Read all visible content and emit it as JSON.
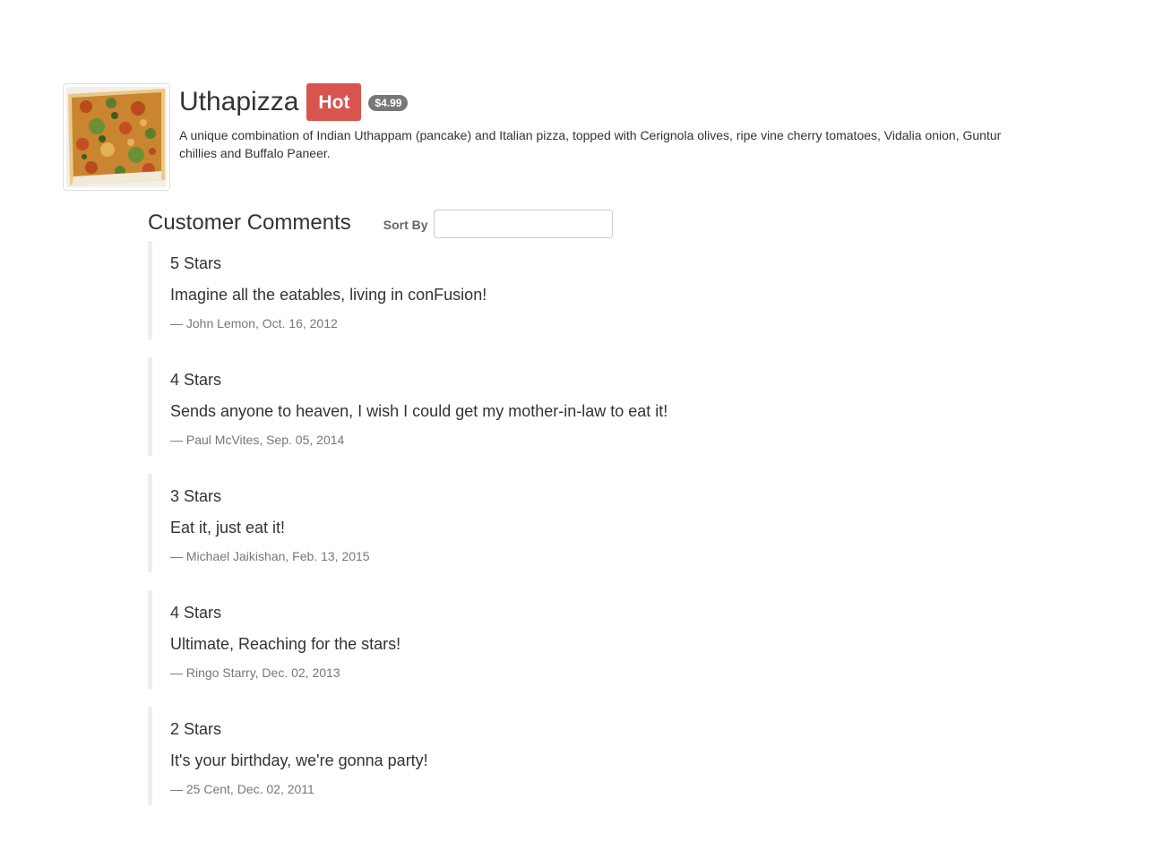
{
  "dish": {
    "name": "Uthapizza",
    "label": "Hot",
    "price": "$4.99",
    "description": "A unique combination of Indian Uthappam (pancake) and Italian pizza, topped with Cerignola olives, ripe vine cherry tomatoes, Vidalia onion, Guntur chillies and Buffalo Paneer.",
    "image_icon": "pizza-image",
    "label_color": "#d9534f",
    "badge_color": "#777777"
  },
  "comments_section": {
    "title": "Customer Comments",
    "sort_label": "Sort By",
    "sort_value": "",
    "sort_placeholder": ""
  },
  "comments": [
    {
      "rating": "5 Stars",
      "text": "Imagine all the eatables, living in conFusion!",
      "footer": "— John Lemon, Oct. 16, 2012"
    },
    {
      "rating": "4 Stars",
      "text": "Sends anyone to heaven, I wish I could get my mother-in-law to eat it!",
      "footer": "— Paul McVites, Sep. 05, 2014"
    },
    {
      "rating": "3 Stars",
      "text": "Eat it, just eat it!",
      "footer": "— Michael Jaikishan, Feb. 13, 2015"
    },
    {
      "rating": "4 Stars",
      "text": "Ultimate, Reaching for the stars!",
      "footer": "— Ringo Starry, Dec. 02, 2013"
    },
    {
      "rating": "2 Stars",
      "text": "It's your birthday, we're gonna party!",
      "footer": "— 25 Cent, Dec. 02, 2011"
    }
  ]
}
